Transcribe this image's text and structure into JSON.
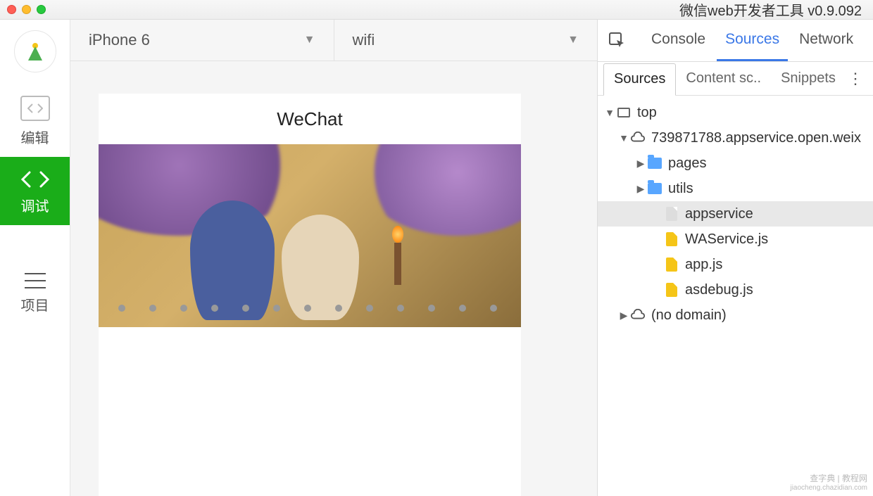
{
  "window": {
    "title": "微信web开发者工具 v0.9.092"
  },
  "sidebar": {
    "items": [
      {
        "label": "编辑"
      },
      {
        "label": "调试"
      },
      {
        "label": "项目"
      }
    ]
  },
  "toolbar": {
    "device": "iPhone 6",
    "network": "wifi"
  },
  "preview": {
    "title": "WeChat"
  },
  "devtools": {
    "tabs": {
      "console": "Console",
      "sources": "Sources",
      "network": "Network"
    },
    "subtabs": {
      "sources": "Sources",
      "content": "Content sc..",
      "snippets": "Snippets"
    },
    "tree": {
      "top": "top",
      "domain": "739871788.appservice.open.weix",
      "pages": "pages",
      "utils": "utils",
      "appservice": "appservice",
      "waservice": "WAService.js",
      "appjs": "app.js",
      "asdebug": "asdebug.js",
      "nodomain": "(no domain)"
    }
  },
  "watermark": {
    "line1": "查字典 | 教程网",
    "line2": "jiaocheng.chazidian.com"
  }
}
